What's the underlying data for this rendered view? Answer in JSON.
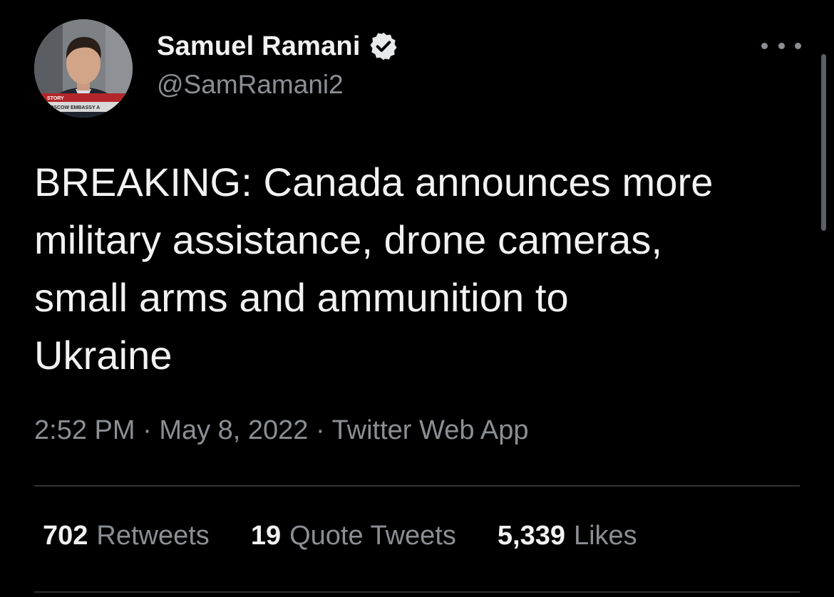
{
  "author": {
    "display_name": "Samuel Ramani",
    "handle": "@SamRamani2",
    "verified": true,
    "avatar_caption_top": "STORY",
    "avatar_caption_bottom": "MOSCOW EMBASSY A"
  },
  "tweet": {
    "text": "BREAKING: Canada announces more\nmilitary assistance, drone cameras,\nsmall arms and ammunition to\nUkraine",
    "time": "2:52 PM",
    "date": "May 8, 2022",
    "source": "Twitter Web App",
    "separator": "·"
  },
  "stats": {
    "retweets_count": "702",
    "retweets_label": "Retweets",
    "quotes_count": "19",
    "quotes_label": "Quote Tweets",
    "likes_count": "5,339",
    "likes_label": "Likes"
  },
  "icons": {
    "verified": "verified-badge-icon",
    "more": "more-options-icon"
  },
  "colors": {
    "background": "#000000",
    "primary_text": "#f2f2f2",
    "secondary_text": "#8b8f94",
    "divider": "#2f3336"
  }
}
